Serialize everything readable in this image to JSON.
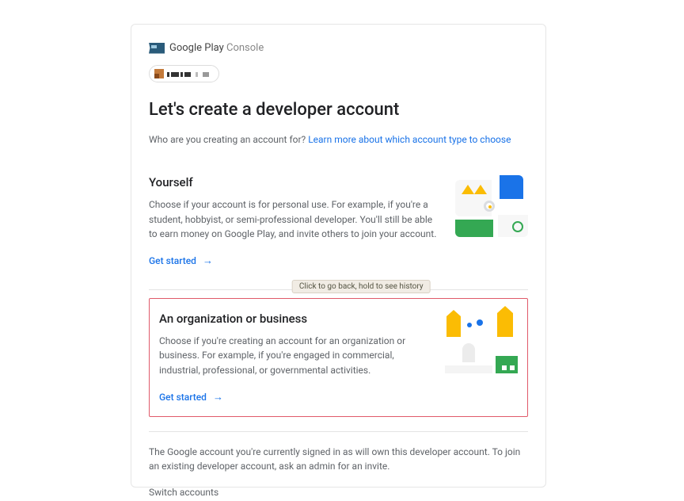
{
  "header": {
    "logo_primary": "Google Play",
    "logo_secondary": "Console"
  },
  "page": {
    "title": "Let's create a developer account",
    "subtitle_prefix": "Who are you creating an account for? ",
    "subtitle_link": "Learn more about which account type to choose"
  },
  "tooltip": "Click to go back, hold to see history",
  "options": {
    "yourself": {
      "heading": "Yourself",
      "description": "Choose if your account is for personal use. For example, if you're a student, hobbyist, or semi-professional developer. You'll still be able to earn money on Google Play, and invite others to join your account.",
      "cta": "Get started"
    },
    "organization": {
      "heading": "An organization or business",
      "description": "Choose if you're creating an account for an organization or business. For example, if you're engaged in commercial, industrial, professional, or governmental activities.",
      "cta": "Get started"
    }
  },
  "footer": {
    "note": "The Google account you're currently signed in as will own this developer account. To join an existing developer account, ask an admin for an invite.",
    "switch": "Switch accounts"
  }
}
